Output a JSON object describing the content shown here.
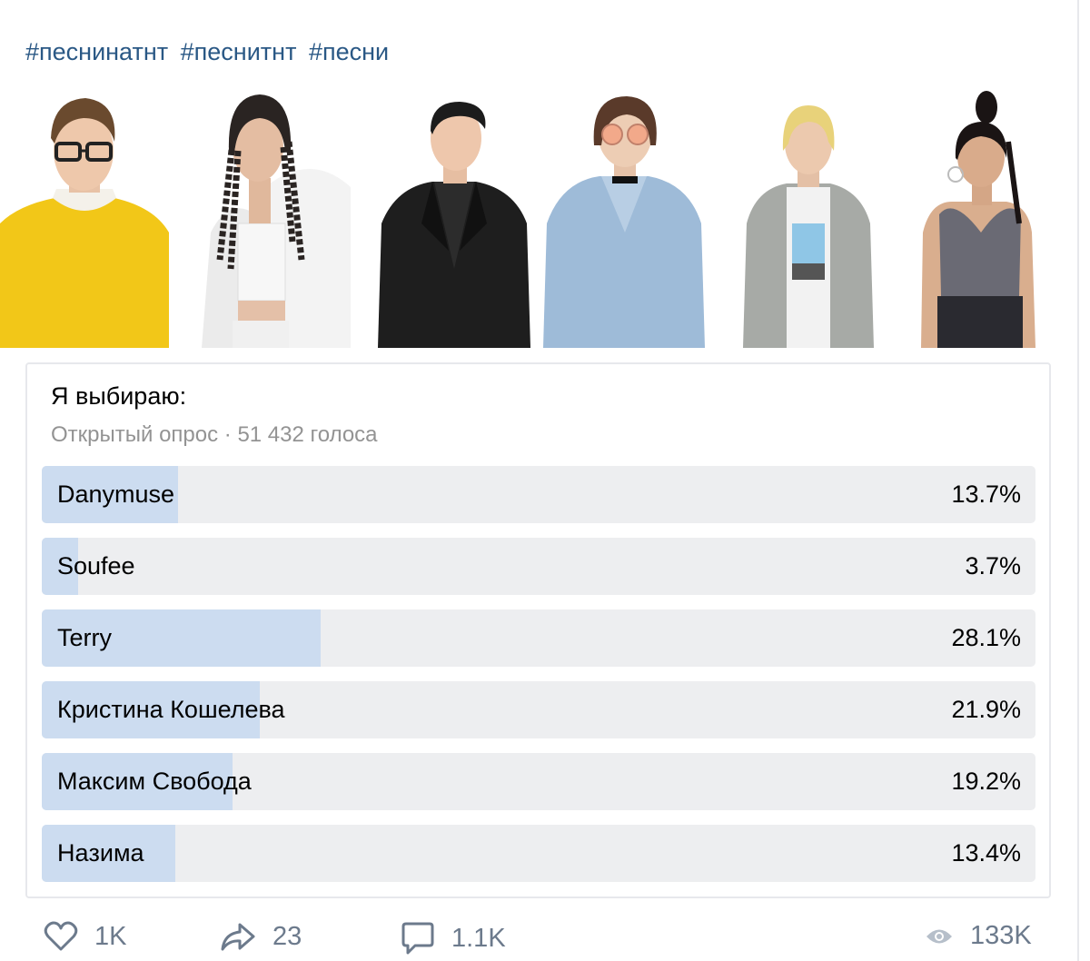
{
  "post": {
    "hashtags": [
      "#песнинатнт",
      "#песнитнт",
      "#песни"
    ]
  },
  "photos": [
    {
      "name": "yellow-sweater-man",
      "bg": "#ffffff"
    },
    {
      "name": "braids-woman-fur",
      "bg": "#ffffff"
    },
    {
      "name": "leather-jacket-man",
      "bg": "#ffffff"
    },
    {
      "name": "denim-shirt-woman",
      "bg": "#ffffff"
    },
    {
      "name": "grey-shirt-man",
      "bg": "#ffffff"
    },
    {
      "name": "sequin-top-woman",
      "bg": "#ffffff"
    }
  ],
  "poll": {
    "title": "Я выбираю:",
    "meta": "Открытый опрос · 51 432 голоса",
    "options": [
      {
        "label": "Danymuse",
        "percent_text": "13.7%",
        "percent": 13.7
      },
      {
        "label": "Soufee",
        "percent_text": "3.7%",
        "percent": 3.7
      },
      {
        "label": "Terry",
        "percent_text": "28.1%",
        "percent": 28.1
      },
      {
        "label": "Кристина Кошелева",
        "percent_text": "21.9%",
        "percent": 21.9
      },
      {
        "label": "Максим Свобода",
        "percent_text": "19.2%",
        "percent": 19.2
      },
      {
        "label": "Haзима",
        "percent_text": "13.4%",
        "percent": 13.4
      }
    ]
  },
  "actions": {
    "likes": "1K",
    "shares": "23",
    "comments": "1.1K",
    "views": "133K"
  },
  "colors": {
    "link": "#2a5885",
    "bar_fill": "#ccdcf0",
    "bar_track": "#edeef0",
    "muted": "#939393",
    "icon": "#6c7a8c"
  }
}
